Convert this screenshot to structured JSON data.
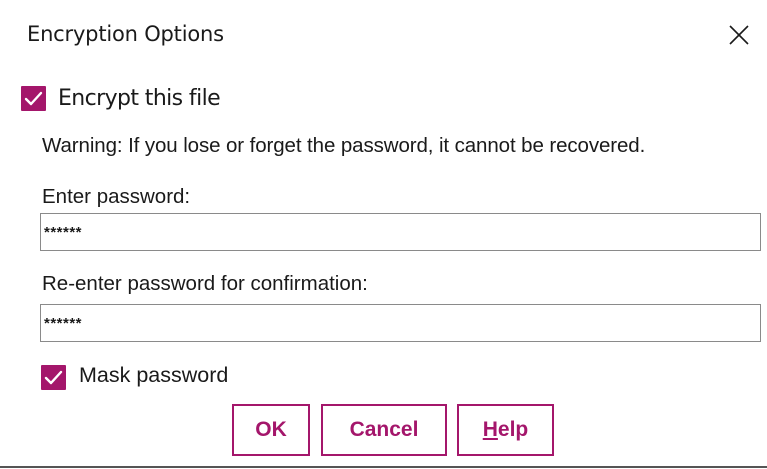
{
  "dialog": {
    "title": "Encryption Options",
    "close_icon": "close-icon"
  },
  "encrypt": {
    "label": "Encrypt this file",
    "checked": true
  },
  "warning": "Warning: If you lose or forget the password, it cannot be recovered.",
  "password": {
    "label": "Enter password:",
    "value": "******"
  },
  "confirm_password": {
    "label": "Re-enter password for confirmation:",
    "value": "******"
  },
  "mask": {
    "label": "Mask password",
    "checked": true
  },
  "buttons": {
    "ok": "OK",
    "cancel": "Cancel",
    "help_mnemonic": "H",
    "help_rest": "elp"
  },
  "colors": {
    "accent": "#a4166b",
    "text": "#1a1a1a",
    "field_border": "#8a8a8a"
  }
}
